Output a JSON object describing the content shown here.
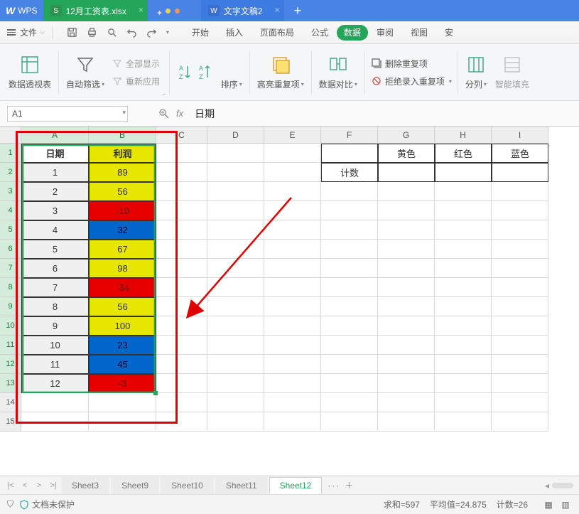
{
  "titlebar": {
    "app": "WPS",
    "tabs": [
      {
        "icon": "S",
        "label": "12月工资表.xlsx",
        "active": true
      },
      {
        "icon": "W",
        "label": "文字文稿2",
        "active": false
      }
    ]
  },
  "file_menu": {
    "label": "文件"
  },
  "menus": [
    "开始",
    "插入",
    "页面布局",
    "公式",
    "数据",
    "审阅",
    "视图",
    "安"
  ],
  "active_menu": "数据",
  "ribbon": {
    "pivot": "数据透视表",
    "autofilter": "自动筛选",
    "showall": "全部显示",
    "reapply": "重新应用",
    "sort": "排序",
    "highlightdup": "高亮重复项",
    "datacompare": "数据对比",
    "removedup": "删除重复项",
    "rejectdup": "拒绝录入重复项",
    "textcol": "分列",
    "smartfill": "智能填充"
  },
  "namebox": "A1",
  "formulavalue": "日期",
  "columns": [
    "A",
    "B",
    "C",
    "D",
    "E",
    "F",
    "G",
    "H",
    "I"
  ],
  "rownums": [
    "1",
    "2",
    "3",
    "4",
    "5",
    "6",
    "7",
    "8",
    "9",
    "10",
    "11",
    "12",
    "13",
    "14",
    "15"
  ],
  "tableA": {
    "headers": [
      "日期",
      "利润"
    ],
    "rows": [
      {
        "d": "1",
        "p": "89",
        "c": "y"
      },
      {
        "d": "2",
        "p": "56",
        "c": "y"
      },
      {
        "d": "3",
        "p": "-10",
        "c": "r"
      },
      {
        "d": "4",
        "p": "32",
        "c": "b"
      },
      {
        "d": "5",
        "p": "67",
        "c": "y"
      },
      {
        "d": "6",
        "p": "98",
        "c": "y"
      },
      {
        "d": "7",
        "p": "-34",
        "c": "r"
      },
      {
        "d": "8",
        "p": "56",
        "c": "y"
      },
      {
        "d": "9",
        "p": "100",
        "c": "y"
      },
      {
        "d": "10",
        "p": "23",
        "c": "b"
      },
      {
        "d": "11",
        "p": "45",
        "c": "b"
      },
      {
        "d": "12",
        "p": "-3",
        "c": "r"
      }
    ]
  },
  "tableB": {
    "row1": [
      "",
      "黄色",
      "红色",
      "蓝色"
    ],
    "row2_label": "计数"
  },
  "sheet_tabs": [
    "Sheet3",
    "Sheet9",
    "Sheet10",
    "Sheet11",
    "Sheet12"
  ],
  "active_sheet": "Sheet12",
  "status": {
    "protect": "文档未保护",
    "sum": "求和=597",
    "avg": "平均值=24.875",
    "count": "计数=26"
  }
}
